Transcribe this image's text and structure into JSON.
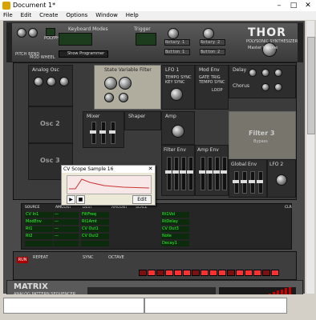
{
  "window": {
    "title": "Document 1*",
    "minimize": "–",
    "maximize": "□",
    "close": "✕"
  },
  "menu": [
    "File",
    "Edit",
    "Create",
    "Options",
    "Window",
    "Help"
  ],
  "header": {
    "logo_text": "THOR",
    "brand": "POLYSONIC SYNTHESIZER",
    "keyboard_modes_label": "Keyboard Modes",
    "trigger_label": "Trigger",
    "show_programmer": "Show Programmer",
    "master_volume": "Master Volume",
    "pitch": "PITCH BEND",
    "mod": "MOD WHEEL",
    "polyphony": "POLYPHONY",
    "rotary1": "Rotary 1",
    "rotary2": "Rotary 2",
    "button1": "Button 1",
    "button2": "Button 2",
    "rbt1": "BUTTON 1",
    "rbt2": "BUTTON 2"
  },
  "modules": {
    "analog_osc": "Analog Osc",
    "osc2": "Osc 2",
    "osc3": "Osc 3",
    "state_var_filter": "State Variable Filter",
    "lfo1": "LFO 1",
    "mod_env": "Mod Env",
    "delay": "Delay",
    "chorus": "Chorus",
    "mixer": "Mixer",
    "shaper": "Shaper",
    "amp": "Amp",
    "filter_env": "Filter Env",
    "amp_env": "Amp Env",
    "filter3": "Filter 3",
    "bypass": "Bypass",
    "global_env": "Global Env",
    "lfo2": "LFO 2",
    "tempo_sync": "TEMPO SYNC",
    "gate_trig": "GATE TRIG",
    "key_sync": "KEY SYNC",
    "loop": "LOOP"
  },
  "cv_window": {
    "title": "CV Scope Sample 16",
    "edit": "Edit",
    "play": "▶",
    "stop": "■"
  },
  "mod_matrix": {
    "headers": [
      "SOURCE",
      "AMOUNT",
      "DEST",
      "AMOUNT",
      "SCALE",
      "CLR"
    ],
    "rows": [
      [
        "CV In1",
        "—",
        "FiltFreq",
        "—",
        "—"
      ],
      [
        "ModEnv",
        "—",
        "Rt1Amt",
        "—",
        "—"
      ],
      [
        "Rt1",
        "—",
        "CV Out1",
        "—",
        "—"
      ],
      [
        "Rt2",
        "—",
        "CV Out2",
        "—",
        "—"
      ],
      [
        "",
        "",
        "",
        "",
        ""
      ]
    ],
    "right_rows": [
      "Rt1Vol",
      "RtDelay",
      "CV Out3",
      "Note",
      "Decay1"
    ]
  },
  "bottom": {
    "run": "RUN",
    "repeat": "REPEAT",
    "sync": "SYNC",
    "octave": "OCTAVE",
    "step_count": 16,
    "steps_on": [
      0,
      1,
      0,
      1,
      1,
      1,
      0,
      1,
      1,
      1,
      0,
      1,
      1,
      1,
      0,
      1
    ]
  },
  "matrix": {
    "name": "MATRIX",
    "subtitle": "ANALOG PATTERN SEQUENCER",
    "bars": [
      3,
      5,
      8,
      10,
      12,
      14,
      16,
      18,
      20,
      22,
      24,
      26,
      28,
      30,
      32,
      34,
      36,
      38
    ]
  },
  "transport": {
    "left_field": "",
    "right_field": ""
  }
}
